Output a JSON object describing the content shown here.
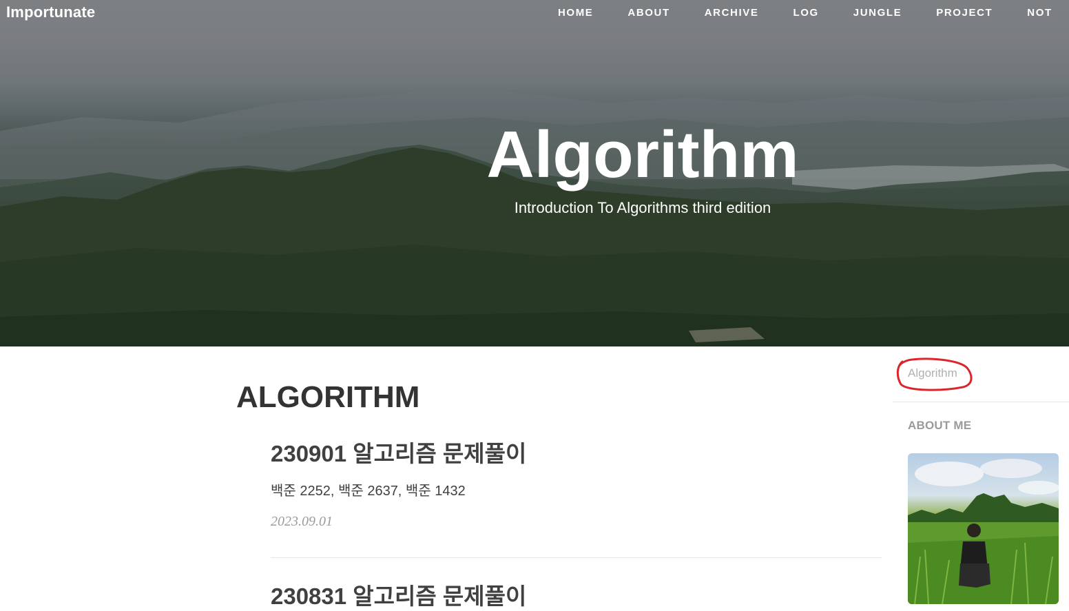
{
  "header": {
    "brand": "Importunate",
    "nav_items": [
      "HOME",
      "ABOUT",
      "ARCHIVE",
      "LOG",
      "JUNGLE",
      "PROJECT",
      "NOT"
    ]
  },
  "hero": {
    "title": "Algorithm",
    "subtitle": "Introduction To Algorithms third edition"
  },
  "main": {
    "heading": "ALGORITHM",
    "posts": [
      {
        "title": "230901 알고리즘 문제풀이",
        "subtitle": "백준 2252, 백준 2637, 백준 1432",
        "date": "2023.09.01"
      },
      {
        "title": "230831 알고리즘 문제풀이"
      }
    ]
  },
  "sidebar": {
    "tag": "Algorithm",
    "about_heading": "ABOUT ME"
  },
  "colors": {
    "annotation_circle": "#d9252b",
    "text_dark": "#404040",
    "text_muted": "#9a9a9a"
  }
}
